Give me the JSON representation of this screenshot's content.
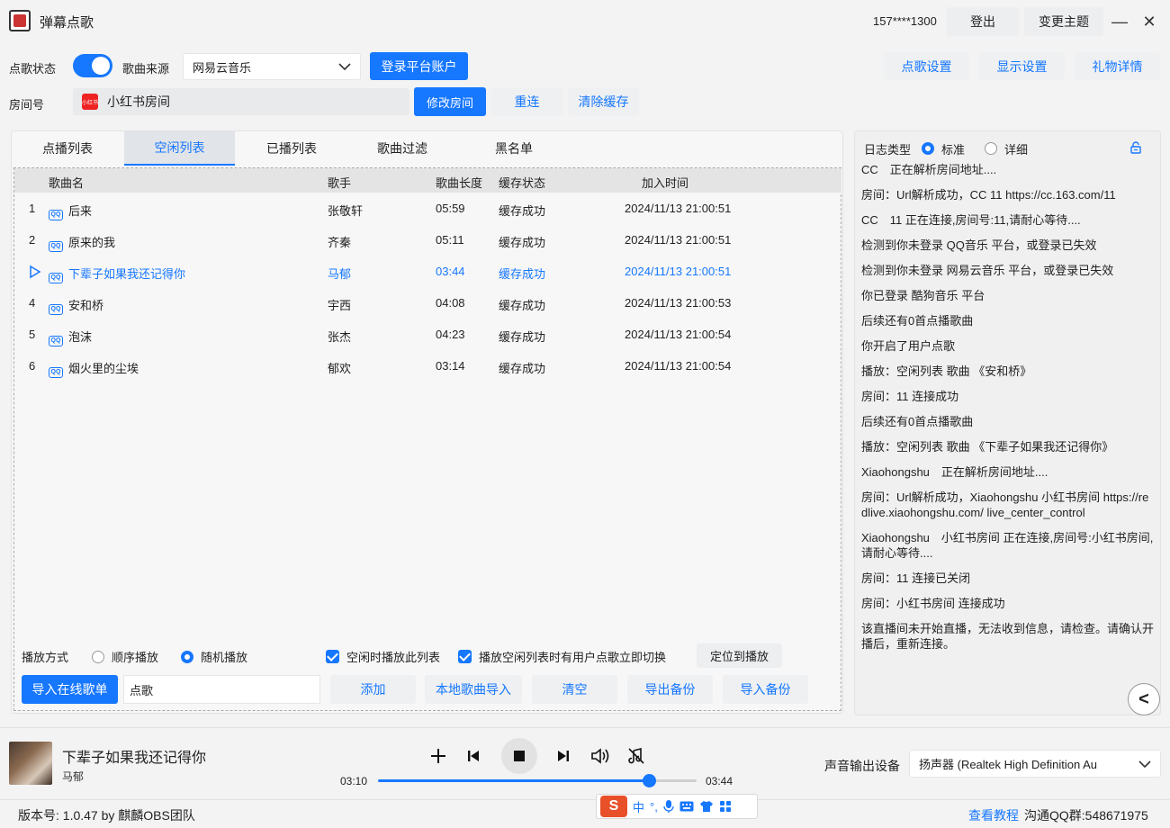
{
  "window": {
    "title": "弹幕点歌",
    "account": "157****1300",
    "logout_label": "登出",
    "theme_label": "变更主题",
    "minimize": "—",
    "close": "✕"
  },
  "controls": {
    "status_label": "点歌状态",
    "source_label": "歌曲来源",
    "source_value": "网易云音乐",
    "login_label": "登录平台账户",
    "song_settings_label": "点歌设置",
    "display_settings_label": "显示设置",
    "gift_details_label": "礼物详情",
    "room_label": "房间号",
    "room_logo_text": "小红书",
    "room_value": "小红书房间",
    "modify_room_label": "修改房间",
    "reconnect_label": "重连",
    "clear_cache_label": "清除缓存"
  },
  "tabs": [
    "点播列表",
    "空闲列表",
    "已播列表",
    "歌曲过滤",
    "黑名单"
  ],
  "active_tab": 1,
  "table": {
    "headers": [
      "歌曲名",
      "歌手",
      "歌曲长度",
      "缓存状态",
      "加入时间"
    ],
    "source_badge": "QQ",
    "rows": [
      {
        "index": "1",
        "title": "后来",
        "artist": "张敬轩",
        "length": "05:59",
        "status": "缓存成功",
        "added": "2024/11/13 21:00:51"
      },
      {
        "index": "2",
        "title": "原来的我",
        "artist": "齐秦",
        "length": "05:11",
        "status": "缓存成功",
        "added": "2024/11/13 21:00:51"
      },
      {
        "index": "",
        "title": "下辈子如果我还记得你",
        "artist": "马郁",
        "length": "03:44",
        "status": "缓存成功",
        "added": "2024/11/13 21:00:51",
        "playing": true
      },
      {
        "index": "4",
        "title": "安和桥",
        "artist": "宇西",
        "length": "04:08",
        "status": "缓存成功",
        "added": "2024/11/13 21:00:53"
      },
      {
        "index": "5",
        "title": "泡沫",
        "artist": "张杰",
        "length": "04:23",
        "status": "缓存成功",
        "added": "2024/11/13 21:00:54"
      },
      {
        "index": "6",
        "title": "烟火里的尘埃",
        "artist": "郁欢",
        "length": "03:14",
        "status": "缓存成功",
        "added": "2024/11/13 21:00:54"
      }
    ]
  },
  "list_controls": {
    "play_mode_label": "播放方式",
    "sequential_label": "顺序播放",
    "random_label": "随机播放",
    "idle_play_label": "空闲时播放此列表",
    "switch_label": "播放空闲列表时有用户点歌立即切换",
    "locate_label": "定位到播放",
    "import_online_label": "导入在线歌单",
    "playlist_input_value": "点歌",
    "add_label": "添加",
    "local_import_label": "本地歌曲导入",
    "clear_label": "清空",
    "export_backup_label": "导出备份",
    "import_backup_label": "导入备份"
  },
  "log": {
    "type_label": "日志类型",
    "standard_label": "标准",
    "detail_label": "详细",
    "lines": [
      "CC　正在解析房间地址....",
      "房间：Url解析成功，CC 11 https://cc.163.com/11",
      "CC　11 正在连接,房间号:11,请耐心等待....",
      "检测到你未登录 QQ音乐 平台，或登录已失效",
      "检测到你未登录 网易云音乐 平台，或登录已失效",
      "你已登录 酷狗音乐 平台",
      "后续还有0首点播歌曲",
      "你开启了用户点歌",
      "播放：空闲列表 歌曲 《安和桥》",
      "房间：11 连接成功",
      "后续还有0首点播歌曲",
      "播放：空闲列表 歌曲 《下辈子如果我还记得你》",
      "Xiaohongshu　正在解析房间地址....",
      "房间：Url解析成功，Xiaohongshu 小红书房间 https://redlive.xiaohongshu.com/ live_center_control",
      "Xiaohongshu　小红书房间 正在连接,房间号:小红书房间,请耐心等待....",
      "房间：11 连接已关闭",
      "房间：小红书房间 连接成功",
      "该直播间未开始直播，无法收到信息，请检查。请确认开播后，重新连接。"
    ],
    "collapse_glyph": "<"
  },
  "player": {
    "title": "下辈子如果我还记得你",
    "artist": "马郁",
    "current_time": "03:10",
    "total_time": "03:44",
    "progress_fraction": 0.85,
    "output_label": "声音输出设备",
    "output_value": "扬声器 (Realtek High Definition Au"
  },
  "status": {
    "version": "版本号: 1.0.47 by 麒麟OBS团队",
    "tutorial": "查看教程",
    "qq_group": "沟通QQ群:548671975"
  },
  "ime": {
    "logo": "S",
    "zh": "中",
    "punct": "°,"
  },
  "colors": {
    "accent": "#1677ff"
  }
}
